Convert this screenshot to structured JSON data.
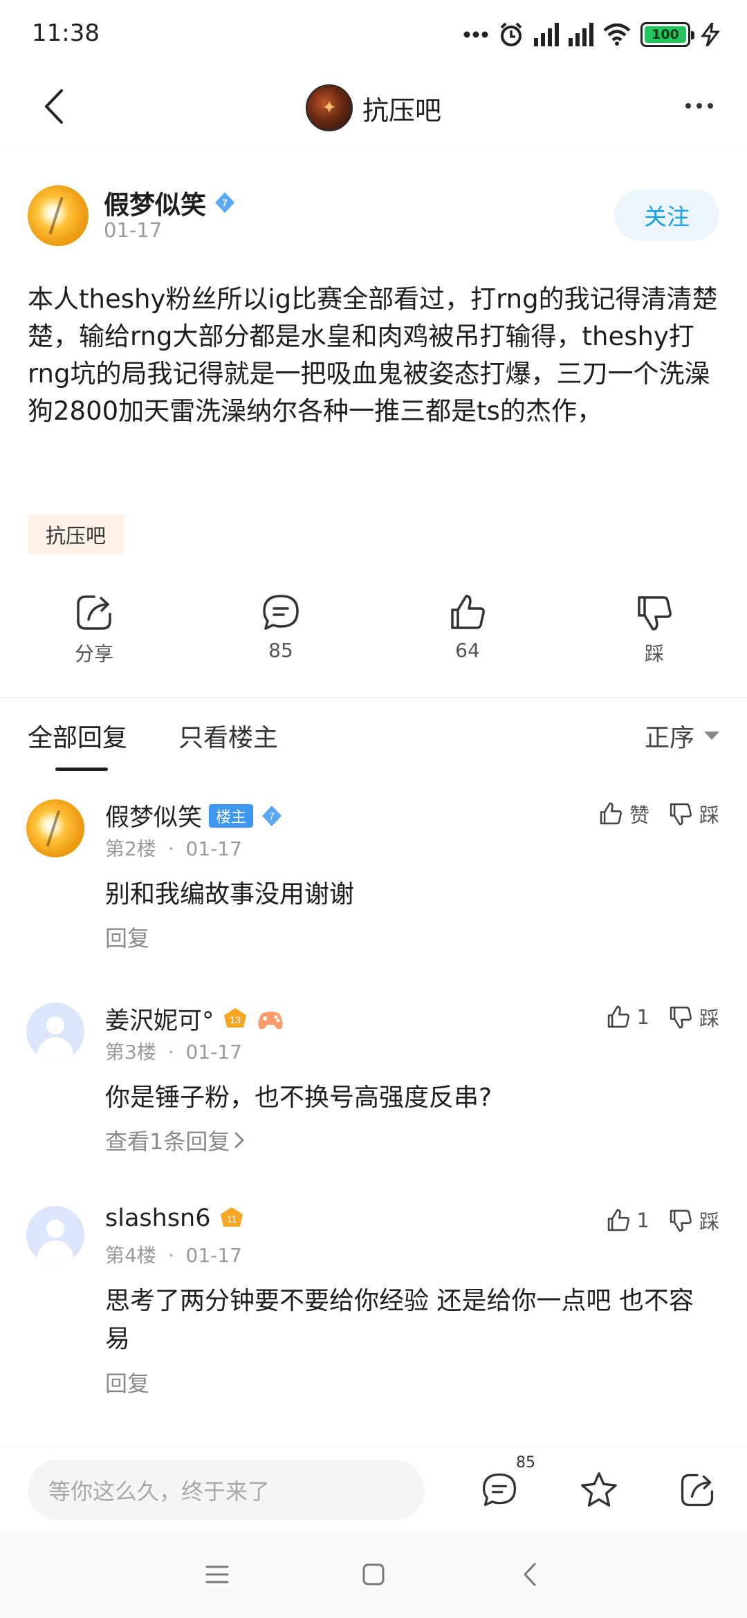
{
  "status_bar": {
    "time": "11:38",
    "battery": "100"
  },
  "header": {
    "forum_name": "抗压吧"
  },
  "post": {
    "author": "假梦似笑",
    "level": "7",
    "date": "01-17",
    "follow_label": "关注",
    "body": "本人theshy粉丝所以ig比赛全部看过，打rng的我记得清清楚楚，输给rng大部分都是水皇和肉鸡被吊打输得，theshy打rng坑的局我记得就是一把吸血鬼被姿态打爆，三刀一个洗澡狗2800加天雷洗澡纳尔各种一推三都是ts的杰作，",
    "tag": "抗压吧",
    "actions": {
      "share_label": "分享",
      "comment_count": "85",
      "like_count": "64",
      "dislike_label": "踩"
    }
  },
  "reply_tabs": {
    "all": "全部回复",
    "owner_only": "只看楼主",
    "sort": "正序"
  },
  "comments": [
    {
      "author": "假梦似笑",
      "owner_badge": "楼主",
      "level": "7",
      "floor": "第2楼",
      "dot": "·",
      "date": "01-17",
      "text": "别和我编故事没用谢谢",
      "sub": "回复",
      "like": "赞",
      "dislike": "踩"
    },
    {
      "author": "姜沢妮可°",
      "level": "13",
      "floor": "第3楼",
      "dot": "·",
      "date": "01-17",
      "text": "你是锤子粉，也不换号高强度反串?",
      "sub": "查看1条回复",
      "like": "1",
      "dislike": "踩"
    },
    {
      "author": "slashsn6",
      "level": "11",
      "floor": "第4楼",
      "dot": "·",
      "date": "01-17",
      "text": "思考了两分钟要不要给你经验 还是给你一点吧 也不容易",
      "sub": "回复",
      "like": "1",
      "dislike": "踩"
    }
  ],
  "bottom_bar": {
    "input_placeholder": "等你这么久，终于来了",
    "comment_count": "85"
  },
  "colors": {
    "accent": "#1aa1e5",
    "owner_badge": "#3b97f2",
    "level_badge": "#5aa8f5",
    "hat_badge": "#f5a623",
    "battery": "#22c55e"
  }
}
